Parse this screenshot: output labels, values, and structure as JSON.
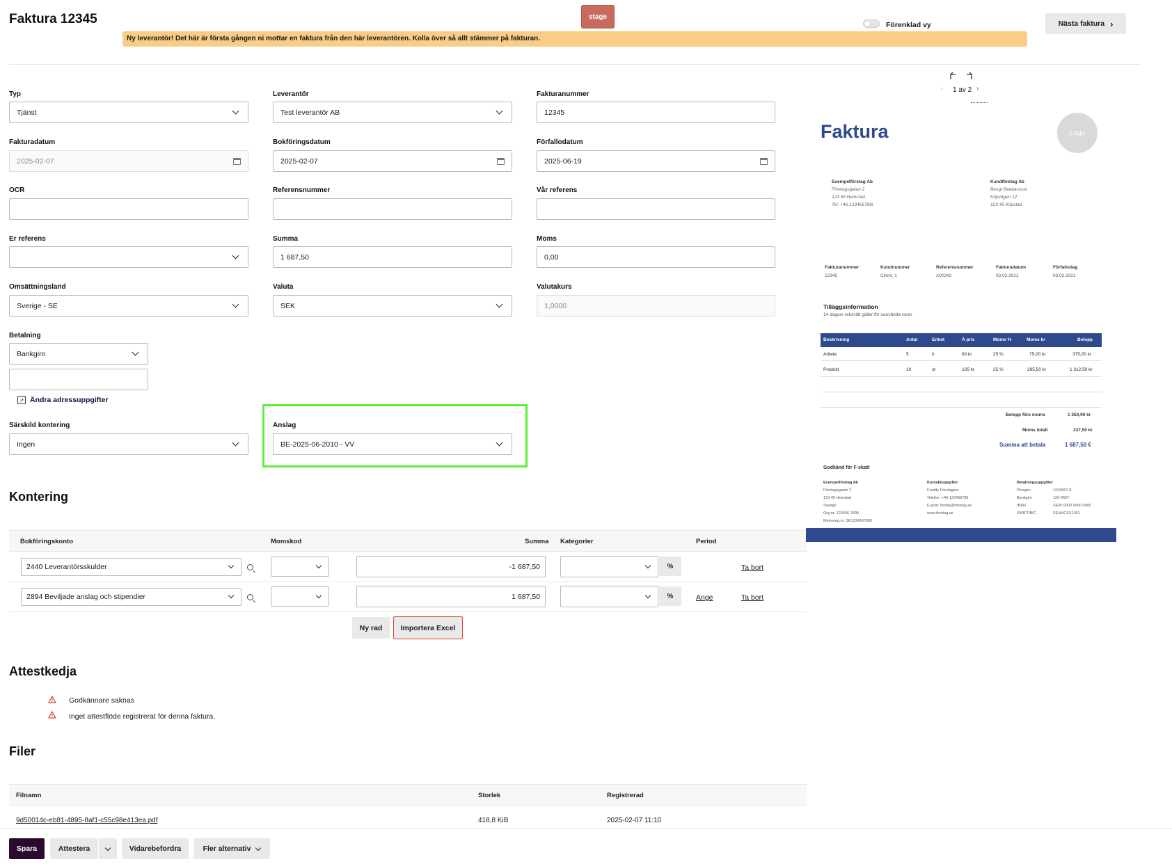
{
  "header": {
    "title": "Faktura 12345",
    "stage_badge": "stage",
    "simplified_view_label": "Förenklad vy",
    "next_invoice_label": "Nästa faktura",
    "banner_text": "Ny leverantör! Det här är första gången ni mottar en faktura från den här leverantören. Kolla över så allt stämmer på fakturan."
  },
  "form": {
    "typ": {
      "label": "Typ",
      "value": "Tjänst"
    },
    "leverantor": {
      "label": "Leverantör",
      "value": "Test leverantör AB"
    },
    "fakturanummer": {
      "label": "Fakturanummer",
      "value": "12345"
    },
    "fakturadatum": {
      "label": "Fakturadatum",
      "value": "2025-02-07"
    },
    "bokforingsdatum": {
      "label": "Bokföringsdatum",
      "value": "2025-02-07"
    },
    "forfallodatum": {
      "label": "Förfallodatum",
      "value": "2025-06-19"
    },
    "ocr": {
      "label": "OCR",
      "value": ""
    },
    "referensnummer": {
      "label": "Referensnummer",
      "value": ""
    },
    "var_referens": {
      "label": "Vår referens",
      "value": ""
    },
    "er_referens": {
      "label": "Er referens",
      "value": ""
    },
    "summa": {
      "label": "Summa",
      "value": "1 687,50"
    },
    "moms": {
      "label": "Moms",
      "value": "0,00"
    },
    "omsattningsland": {
      "label": "Omsättningsland",
      "value": "Sverige - SE"
    },
    "valuta": {
      "label": "Valuta",
      "value": "SEK"
    },
    "valutakurs": {
      "label": "Valutakurs",
      "value": "1,0000"
    },
    "betalning": {
      "label": "Betalning",
      "value": "Bankgiro",
      "account": ""
    },
    "andra_adress": "Ändra adressuppgifter",
    "sarskild_kontering": {
      "label": "Särskild kontering",
      "value": "Ingen"
    },
    "anslag": {
      "label": "Anslag",
      "value": "BE-2025-06-2010 - VV"
    }
  },
  "kontering": {
    "title": "Kontering",
    "columns": [
      "Bokföringskonto",
      "Momskod",
      "Summa",
      "Kategorier",
      "Period"
    ],
    "rows": [
      {
        "konto": "2440 Leverantörsskulder",
        "momskod": "",
        "summa": "-1 687,50",
        "kategori": "",
        "pct": "%",
        "period": "",
        "remove": "Ta bort"
      },
      {
        "konto": "2894 Beviljade anslag och stipendier",
        "momskod": "",
        "summa": "1 687,50",
        "kategori": "",
        "pct": "%",
        "period": "Ange",
        "remove": "Ta bort"
      }
    ],
    "new_row": "Ny rad",
    "import_excel": "Importera Excel"
  },
  "attest": {
    "title": "Attestkedja",
    "warnings": [
      "Godkännare saknas",
      "Inget attestflöde registrerat för denna faktura."
    ]
  },
  "filer": {
    "title": "Filer",
    "columns": [
      "Filnamn",
      "Storlek",
      "Registrerad"
    ],
    "rows": [
      {
        "name": "9d50014c-eb81-4895-8af1-c55c98e413ea.pdf",
        "size": "418,8 KiB",
        "registered": "2025-02-07 11:10"
      }
    ]
  },
  "footer": {
    "save": "Spara",
    "attest": "Attestera",
    "forward": "Vidarebefordra",
    "more": "Fler alternativ"
  },
  "preview": {
    "pager": "1 av 2",
    "title": "Faktura",
    "logo": "Logo",
    "seller": [
      "Exempelföretag Ab",
      "Företagsgatan 2",
      "123 45 Hemstad",
      "Tel: +46-123456789l"
    ],
    "buyer": [
      "Kundföretag Ab",
      "Bengt Betalarsson",
      "Köpvägen 12",
      "123 45 Köpstad"
    ],
    "meta_labels": [
      "Fakturanummer",
      "Kundnummer",
      "Referensnummer",
      "Fakturadatum",
      "Förfallodag"
    ],
    "meta_values": [
      "12345",
      "Client_1",
      "A00342",
      "03.02.2021",
      "03.02.2021"
    ],
    "extra_title": "Tilläggsinformation",
    "extra_text": "14 dagars returrätt gäller för oanvända varor",
    "table_head": [
      "Beskrivning",
      "Antal",
      "Enhet",
      "À pris",
      "Moms %",
      "Moms kr",
      "Belopp"
    ],
    "table_rows": [
      [
        "Arbete",
        "5",
        "h",
        "60 kr",
        "25 %",
        "75,00 kr",
        "375,00 kr"
      ],
      [
        "Produkt",
        "10",
        "st",
        "105 kr",
        "25 %",
        "265,50 kr",
        "1 312,50 kr"
      ]
    ],
    "total_labels": [
      "Belopp före moms",
      "Moms totalt",
      "Summa att betala"
    ],
    "total_values": [
      "1 350,00 kr",
      "337,50 kr",
      "1 687,50 €"
    ],
    "fskatt": "Godkänd för F-skatt",
    "footer_col1": [
      "Exempelföretag Ab",
      "Företagsgatan 2",
      "123 45 Hemstad",
      "Sverige",
      "Org.nr: 123456-7890",
      "Momsreg.nr: SE1234567890"
    ],
    "footer_col2": [
      "Kontaktuppgifter",
      "Freddy Företagare",
      "Telefon: +46-123456789",
      "E-post: freddy@foretag.se",
      "www.foretag.se"
    ],
    "footer_col3_labels": [
      "Betalningsuppgifter",
      "Plusgiro",
      "Bankgiro",
      "IBAN",
      "SWIFT/BIC"
    ],
    "footer_col3_values": [
      "",
      "1234567-8",
      "123-4567",
      "SE00 0000 0000 0000",
      "SEHHCXX1001"
    ],
    "colors": {
      "brand": "#2e4a8c",
      "table_head": "#2e4a8c"
    }
  }
}
